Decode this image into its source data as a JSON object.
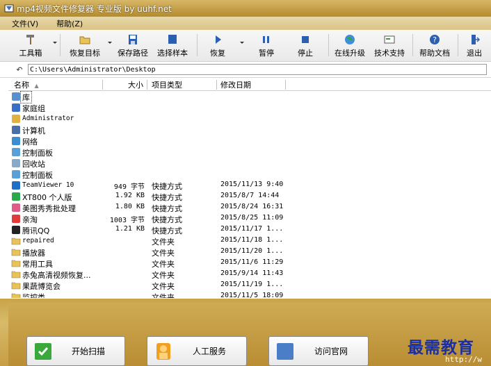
{
  "window": {
    "title": "mp4视频文件修复器 专业版 by uuhf.net"
  },
  "menu": [
    "文件(V)",
    "帮助(Z)"
  ],
  "toolbar": {
    "tools": "工具箱",
    "restore_target": "恢复目标",
    "save_path": "保存路径",
    "select_sample": "选择样本",
    "restore": "恢复",
    "pause": "暂停",
    "stop": "停止",
    "online_upgrade": "在线升级",
    "tech_support": "技术支持",
    "help_doc": "帮助文档",
    "exit": "退出"
  },
  "path": {
    "value": "C:\\Users\\Administrator\\Desktop"
  },
  "columns": {
    "name": "名称",
    "size": "大小",
    "type": "项目类型",
    "date": "修改日期"
  },
  "files": [
    {
      "name": "库",
      "size": "",
      "type": "",
      "date": "",
      "icon": "library-icon"
    },
    {
      "name": "家庭组",
      "size": "",
      "type": "",
      "date": "",
      "icon": "homegroup-icon"
    },
    {
      "name": "Administrator",
      "size": "",
      "type": "",
      "date": "",
      "icon": "user-folder-icon",
      "mono": true
    },
    {
      "name": "计算机",
      "size": "",
      "type": "",
      "date": "",
      "icon": "computer-icon"
    },
    {
      "name": "网络",
      "size": "",
      "type": "",
      "date": "",
      "icon": "network-icon"
    },
    {
      "name": "控制面板",
      "size": "",
      "type": "",
      "date": "",
      "icon": "control-panel-icon"
    },
    {
      "name": "回收站",
      "size": "",
      "type": "",
      "date": "",
      "icon": "recycle-bin-icon"
    },
    {
      "name": "控制面板",
      "size": "",
      "type": "",
      "date": "",
      "icon": "control-panel-icon"
    },
    {
      "name": "TeamViewer 10",
      "size": "949 字节",
      "type": "快捷方式",
      "date": "2015/11/13 9:40",
      "icon": "teamviewer-icon",
      "mono": true
    },
    {
      "name": "XT800 个人版",
      "size": "1.92 KB",
      "type": "快捷方式",
      "date": "2015/8/7 14:44",
      "icon": "xt800-icon"
    },
    {
      "name": "美图秀秀批处理",
      "size": "1.80 KB",
      "type": "快捷方式",
      "date": "2015/8/24 16:31",
      "icon": "meitu-icon"
    },
    {
      "name": "亲淘",
      "size": "1003 字节",
      "type": "快捷方式",
      "date": "2015/8/25 11:09",
      "icon": "qintao-icon"
    },
    {
      "name": "腾讯QQ",
      "size": "1.21 KB",
      "type": "快捷方式",
      "date": "2015/11/17 1...",
      "icon": "qq-icon"
    },
    {
      "name": "repaired",
      "size": "",
      "type": "文件夹",
      "date": "2015/11/18 1...",
      "icon": "folder-icon",
      "mono": true
    },
    {
      "name": "播放器",
      "size": "",
      "type": "文件夹",
      "date": "2015/11/20 1...",
      "icon": "folder-icon"
    },
    {
      "name": "常用工具",
      "size": "",
      "type": "文件夹",
      "date": "2015/11/6 11:29",
      "icon": "folder-icon"
    },
    {
      "name": "赤兔高清视频恢复...",
      "size": "",
      "type": "文件夹",
      "date": "2015/9/14 11:43",
      "icon": "folder-icon"
    },
    {
      "name": "果蔬博览会",
      "size": "",
      "type": "文件夹",
      "date": "2015/11/19 1...",
      "icon": "folder-icon"
    },
    {
      "name": "监控类",
      "size": "",
      "type": "文件夹",
      "date": "2015/11/5 18:09",
      "icon": "folder-icon"
    }
  ],
  "actions": {
    "start_scan": "开始扫描",
    "manual_service": "人工服务",
    "visit_site": "访问官网"
  },
  "watermark": {
    "text": "最需教育",
    "sub": "http://w"
  },
  "colors": {
    "title_bar": "#c9a348",
    "bottom_panel": "#c9a348",
    "watermark": "#1a2fa0"
  }
}
